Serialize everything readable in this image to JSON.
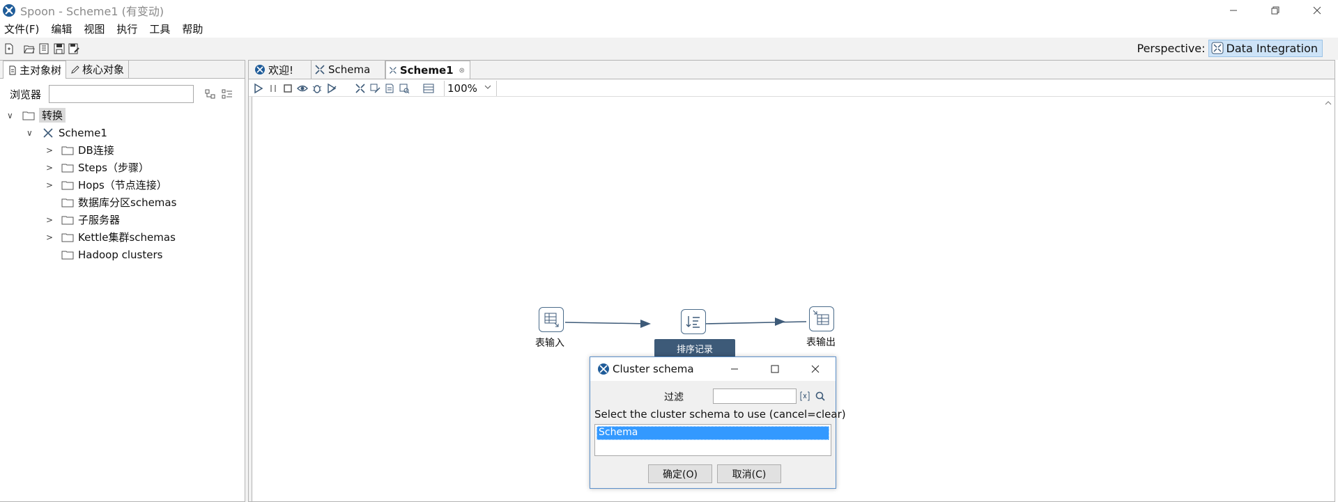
{
  "window": {
    "title": "Spoon - Scheme1 (有变动)",
    "minimize_icon": "minimize-icon",
    "restore_icon": "restore-icon",
    "close_icon": "close-icon"
  },
  "menubar": {
    "items": [
      "文件(F)",
      "编辑",
      "视图",
      "执行",
      "工具",
      "帮助"
    ]
  },
  "perspective": {
    "label": "Perspective:",
    "value": "Data Integration"
  },
  "left_panel": {
    "tabs": [
      "主对象树",
      "核心对象"
    ],
    "browser_label": "浏览器",
    "search_value": "",
    "tree": [
      {
        "label": "转换",
        "level": 0,
        "expanded": true,
        "selected": true
      },
      {
        "label": "Scheme1",
        "level": 1,
        "expanded": true
      },
      {
        "label": "DB连接",
        "level": 2,
        "expandable": true
      },
      {
        "label": "Steps（步骤）",
        "level": 2,
        "expandable": true
      },
      {
        "label": "Hops（节点连接）",
        "level": 2,
        "expandable": true
      },
      {
        "label": "数据库分区schemas",
        "level": 2,
        "expandable": false
      },
      {
        "label": "子服务器",
        "level": 2,
        "expandable": true
      },
      {
        "label": "Kettle集群schemas",
        "level": 2,
        "expandable": true
      },
      {
        "label": "Hadoop clusters",
        "level": 2,
        "expandable": false
      }
    ]
  },
  "editor": {
    "tabs": [
      {
        "label": "欢迎!",
        "active": false
      },
      {
        "label": "Schema",
        "active": false
      },
      {
        "label": "Scheme1",
        "active": true
      }
    ],
    "zoom": "100%"
  },
  "canvas": {
    "steps": [
      {
        "label": "表输入"
      },
      {
        "label": "排序记录"
      },
      {
        "label": "表输出"
      }
    ]
  },
  "dialog": {
    "title": "Cluster schema",
    "filter_label": "过滤",
    "filter_value": "",
    "prompt": "Select the cluster schema to use (cancel=clear)",
    "options": [
      "Schema"
    ],
    "selected": "Schema",
    "ok_label": "确定(O)",
    "cancel_label": "取消(C)"
  }
}
